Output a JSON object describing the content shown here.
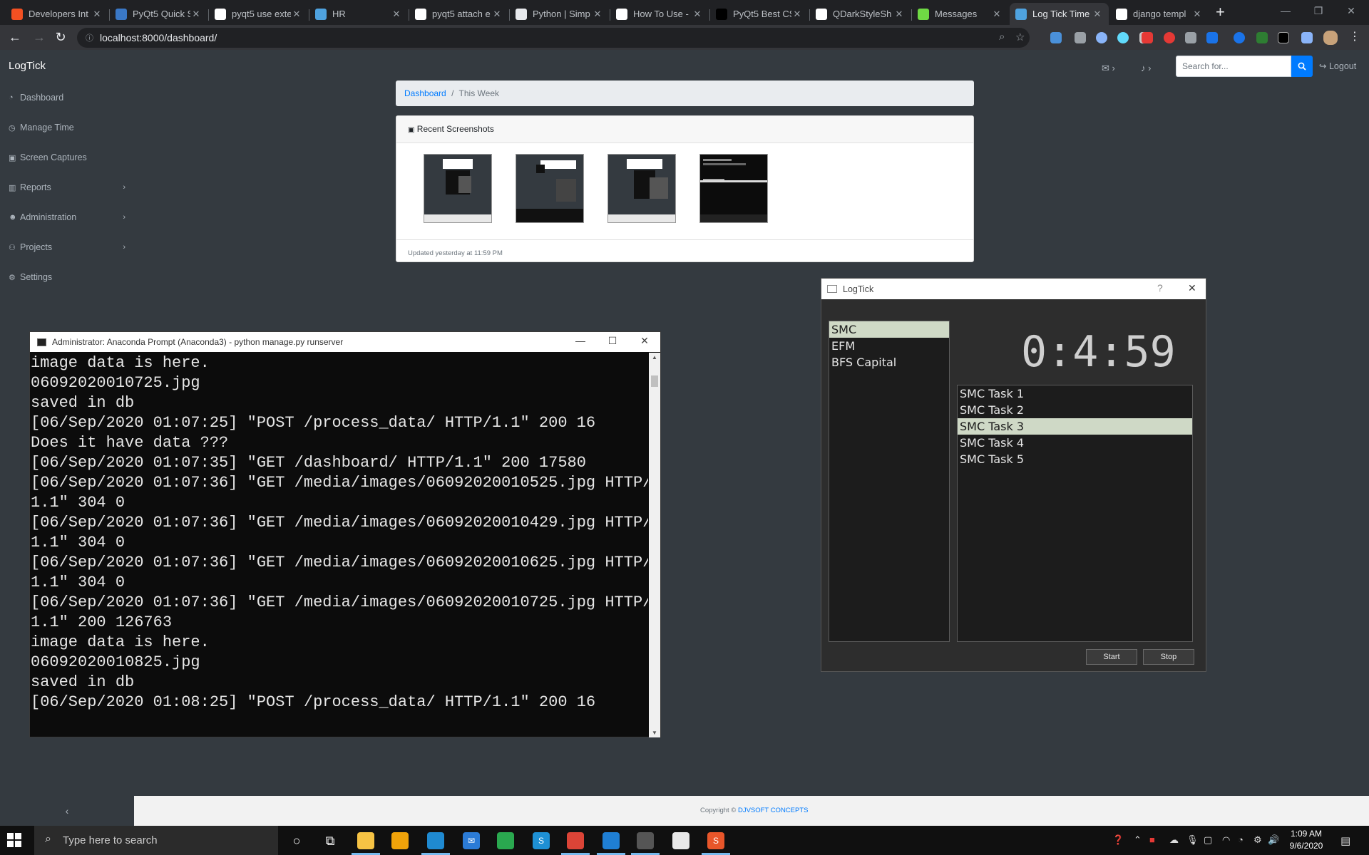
{
  "browser": {
    "tabs": [
      {
        "title": "Developers Int",
        "favicon": "microsoft-icon",
        "color": "#f25022",
        "active": false
      },
      {
        "title": "PyQt5 Quick S",
        "favicon": "web-icon",
        "color": "#3a78c6",
        "active": false
      },
      {
        "title": "pyqt5 use exte",
        "favicon": "google-icon",
        "color": "#ffffff",
        "active": false
      },
      {
        "title": "HR",
        "favicon": "globe-icon",
        "color": "#4fa3e0",
        "active": false
      },
      {
        "title": "pyqt5 attach e",
        "favicon": "google-icon",
        "color": "#ffffff",
        "active": false
      },
      {
        "title": "Python | Simp",
        "favicon": "bug-icon",
        "color": "#e8eaed",
        "active": false
      },
      {
        "title": "How To Use - ",
        "favicon": "circle-icon",
        "color": "#ffffff",
        "active": false
      },
      {
        "title": "PyQt5 Best CS",
        "favicon": "medium-icon",
        "color": "#000000",
        "active": false
      },
      {
        "title": "QDarkStyleSh",
        "favicon": "github-icon",
        "color": "#ffffff",
        "active": false
      },
      {
        "title": "Messages",
        "favicon": "upwork-icon",
        "color": "#6fda44",
        "active": false
      },
      {
        "title": "Log Tick Time",
        "favicon": "globe-icon",
        "color": "#4fa3e0",
        "active": true
      },
      {
        "title": "django templ",
        "favicon": "google-icon",
        "color": "#ffffff",
        "active": false
      }
    ],
    "new_tab": "+",
    "url": "localhost:8000/dashboard/",
    "back": "←",
    "forward": "→",
    "reload": "↻"
  },
  "app": {
    "brand": "LogTick",
    "nav": [
      {
        "label": "Dashboard",
        "icon": "dashboard-icon",
        "glyph": "◔",
        "arrow": ""
      },
      {
        "label": "Manage Time",
        "icon": "clock-icon",
        "glyph": "◷",
        "arrow": ""
      },
      {
        "label": "Screen Captures",
        "icon": "camera-icon",
        "glyph": "▣",
        "arrow": ""
      },
      {
        "label": "Reports",
        "icon": "bar-chart-icon",
        "glyph": "▥",
        "arrow": "›"
      },
      {
        "label": "Administration",
        "icon": "users-icon",
        "glyph": "☻",
        "arrow": "›"
      },
      {
        "label": "Projects",
        "icon": "sitemap-icon",
        "glyph": "⚇",
        "arrow": "›"
      },
      {
        "label": "Settings",
        "icon": "gear-icon",
        "glyph": "⚙",
        "arrow": ""
      }
    ],
    "search_placeholder": "Search for...",
    "logout": "Logout",
    "breadcrumb": {
      "home": "Dashboard",
      "current": "This Week",
      "sep": "/"
    },
    "card": {
      "title": "Recent Screenshots",
      "footer": "Updated yesterday at 11:59 PM"
    },
    "copyright": {
      "prefix": "Copyright ©",
      "company": "DJVSOFT CONCEPTS"
    },
    "sidebar_toggle": "‹"
  },
  "console": {
    "title": "Administrator: Anaconda Prompt (Anaconda3) - python  manage.py runserver",
    "text": "image data is here.\n06092020010725.jpg\nsaved in db\n[06/Sep/2020 01:07:25] \"POST /process_data/ HTTP/1.1\" 200 16\nDoes it have data ???\n[06/Sep/2020 01:07:35] \"GET /dashboard/ HTTP/1.1\" 200 17580\n[06/Sep/2020 01:07:36] \"GET /media/images/06092020010525.jpg HTTP/\n1.1\" 304 0\n[06/Sep/2020 01:07:36] \"GET /media/images/06092020010429.jpg HTTP/\n1.1\" 304 0\n[06/Sep/2020 01:07:36] \"GET /media/images/06092020010625.jpg HTTP/\n1.1\" 304 0\n[06/Sep/2020 01:07:36] \"GET /media/images/06092020010725.jpg HTTP/\n1.1\" 200 126763\nimage data is here.\n06092020010825.jpg\nsaved in db\n[06/Sep/2020 01:08:25] \"POST /process_data/ HTTP/1.1\" 200 16"
  },
  "logtick": {
    "title": "LogTick",
    "help": "?",
    "close": "✕",
    "projects": [
      {
        "label": "SMC",
        "selected": true
      },
      {
        "label": "EFM",
        "selected": false
      },
      {
        "label": "BFS Capital",
        "selected": false
      }
    ],
    "timer": "0:4:59",
    "tasks": [
      {
        "label": "SMC Task 1",
        "selected": false
      },
      {
        "label": "SMC Task 2",
        "selected": false
      },
      {
        "label": "SMC Task 3",
        "selected": true
      },
      {
        "label": "SMC Task 4",
        "selected": false
      },
      {
        "label": "SMC Task 5",
        "selected": false
      }
    ],
    "start": "Start",
    "stop": "Stop"
  },
  "taskbar": {
    "search_placeholder": "Type here to search",
    "time": "1:09 AM",
    "date": "9/6/2020",
    "pinned": [
      {
        "name": "cortana-icon",
        "glyph": "○",
        "color": "transparent"
      },
      {
        "name": "task-view-icon",
        "glyph": "⧉",
        "color": "transparent"
      },
      {
        "name": "file-explorer-icon",
        "glyph": "",
        "color": "#f6c344"
      },
      {
        "name": "store-icon",
        "glyph": "",
        "color": "#f0a30a"
      },
      {
        "name": "edge-icon",
        "glyph": "",
        "color": "#1f8ad1"
      },
      {
        "name": "mail-icon",
        "glyph": "✉",
        "color": "#2b7bd6"
      },
      {
        "name": "edge-dev-icon",
        "glyph": "",
        "color": "#2aa84f"
      },
      {
        "name": "skype-icon",
        "glyph": "S",
        "color": "#1e90d4"
      },
      {
        "name": "chrome-icon",
        "glyph": "",
        "color": "#db4437"
      },
      {
        "name": "vscode-icon",
        "glyph": "",
        "color": "#1f7fd4"
      },
      {
        "name": "terminal-icon",
        "glyph": "",
        "color": "#555555"
      },
      {
        "name": "notepad-icon",
        "glyph": "",
        "color": "#e8e8e8"
      },
      {
        "name": "sublime-icon",
        "glyph": "S",
        "color": "#e8562a"
      }
    ]
  },
  "colors": {
    "page_bg": "#343a40",
    "link": "#007bff",
    "selection": "#cfd9c6"
  }
}
